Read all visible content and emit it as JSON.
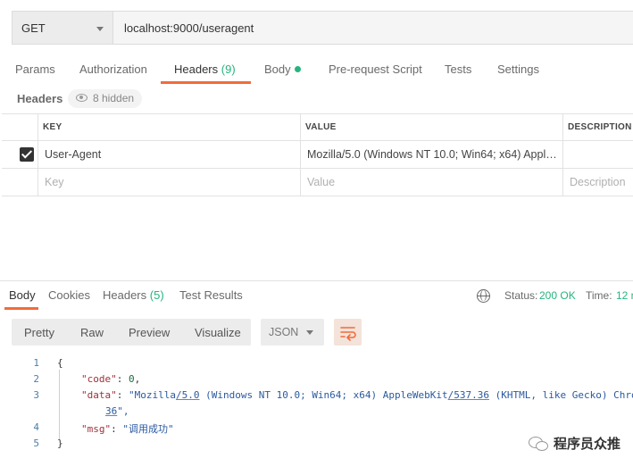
{
  "request": {
    "method": "GET",
    "url": "localhost:9000/useragent"
  },
  "tabs": {
    "params": "Params",
    "authorization": "Authorization",
    "headers": "Headers",
    "headers_count": "(9)",
    "body": "Body",
    "prerequest": "Pre-request Script",
    "tests": "Tests",
    "settings": "Settings"
  },
  "headers_section": {
    "label": "Headers",
    "hidden_label": "8 hidden"
  },
  "table": {
    "columns": [
      "KEY",
      "VALUE",
      "DESCRIPTION"
    ],
    "rows": [
      {
        "checked": true,
        "key": "User-Agent",
        "value": "Mozilla/5.0 (Windows NT 10.0; Win64; x64) Apple...",
        "description": ""
      }
    ],
    "placeholders": {
      "key": "Key",
      "value": "Value",
      "description": "Description"
    }
  },
  "response": {
    "tabs": {
      "body": "Body",
      "cookies": "Cookies",
      "headers": "Headers",
      "headers_count": "(5)",
      "test_results": "Test Results"
    },
    "status_label": "Status:",
    "status_value": "200 OK",
    "time_label": "Time:",
    "time_value": "12 m",
    "view_modes": [
      "Pretty",
      "Raw",
      "Preview",
      "Visualize"
    ],
    "format": "JSON"
  },
  "code": {
    "line_numbers": [
      "1",
      "2",
      "3",
      "4",
      "5"
    ],
    "open_brace": "{",
    "code_key": "\"code\"",
    "code_val": "0",
    "data_key": "\"data\"",
    "data_val_1": "\"Mozilla",
    "data_val_2": "/5.0",
    "data_val_3": " (Windows NT 10.0; Win64; x64) AppleWebKit",
    "data_val_4": "/537.36",
    "data_val_5": " (KHTML, like Gecko) Chro",
    "data_val_wrap": "36",
    "data_val_end": "\",",
    "msg_key": "\"msg\"",
    "msg_val": "\"调用成功\"",
    "close_brace": "}"
  },
  "watermark": "程序员众推",
  "colors": {
    "accent": "#f26b3a",
    "success": "#26b47f"
  }
}
